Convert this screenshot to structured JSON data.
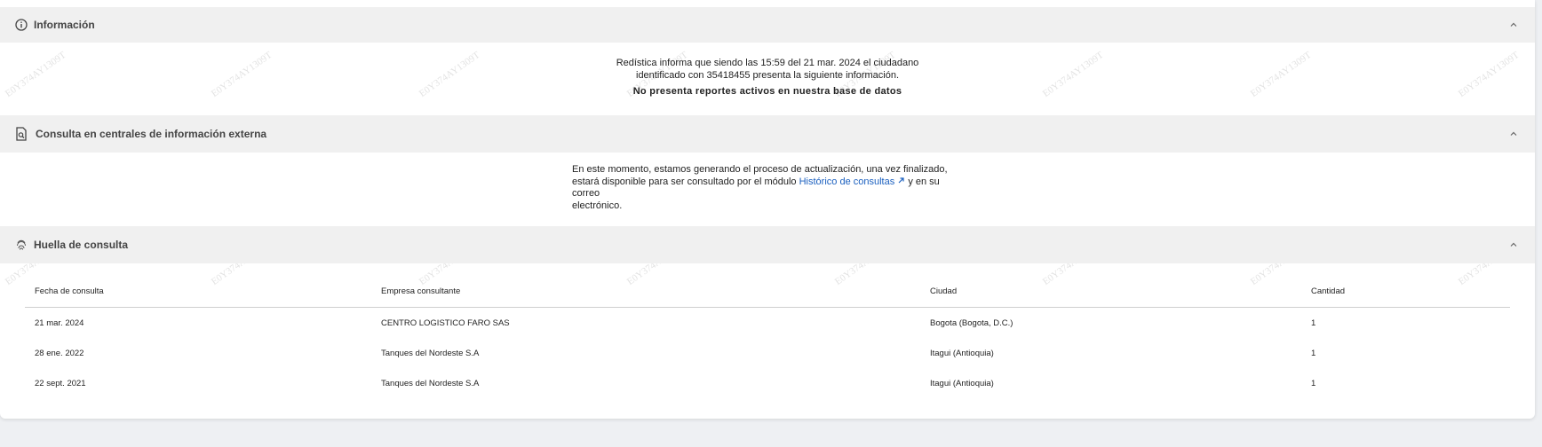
{
  "watermark": "E0Y374AY1309T",
  "informacion": {
    "title": "Información",
    "line1": "Redística informa que siendo las 15:59 del 21 mar. 2024 el ciudadano",
    "line2_prefix": "identificado con ",
    "document_id": "35418455",
    "line2_suffix": " presenta la siguiente información.",
    "status": "No presenta reportes activos en nuestra base de datos"
  },
  "consulta_externa": {
    "title": "Consulta en centrales de información externa",
    "line1": "En este momento, estamos generando el proceso de actualización, una vez finalizado,",
    "line2_prefix": "estará disponible para ser consultado por el módulo ",
    "link_text": "Histórico de consultas",
    "line2_suffix": " y en su correo",
    "line3": "electrónico."
  },
  "huella": {
    "title": "Huella de consulta",
    "columns": [
      "Fecha de consulta",
      "Empresa consultante",
      "Ciudad",
      "Cantidad"
    ],
    "rows": [
      [
        "21 mar. 2024",
        "CENTRO LOGISTICO FARO SAS",
        "Bogota (Bogota, D.C.)",
        "1"
      ],
      [
        "28 ene. 2022",
        "Tanques del Nordeste S.A",
        "Itagui (Antioquia)",
        "1"
      ],
      [
        "22 sept. 2021",
        "Tanques del Nordeste S.A",
        "Itagui (Antioquia)",
        "1"
      ]
    ]
  },
  "colors": {
    "link": "#1a5fbf",
    "header_bg": "#f0f0f0",
    "page_bg": "#eef0f3"
  },
  "icons": [
    "info-icon",
    "document-search-icon",
    "fingerprint-icon",
    "chevron-up-icon",
    "external-link-icon"
  ]
}
